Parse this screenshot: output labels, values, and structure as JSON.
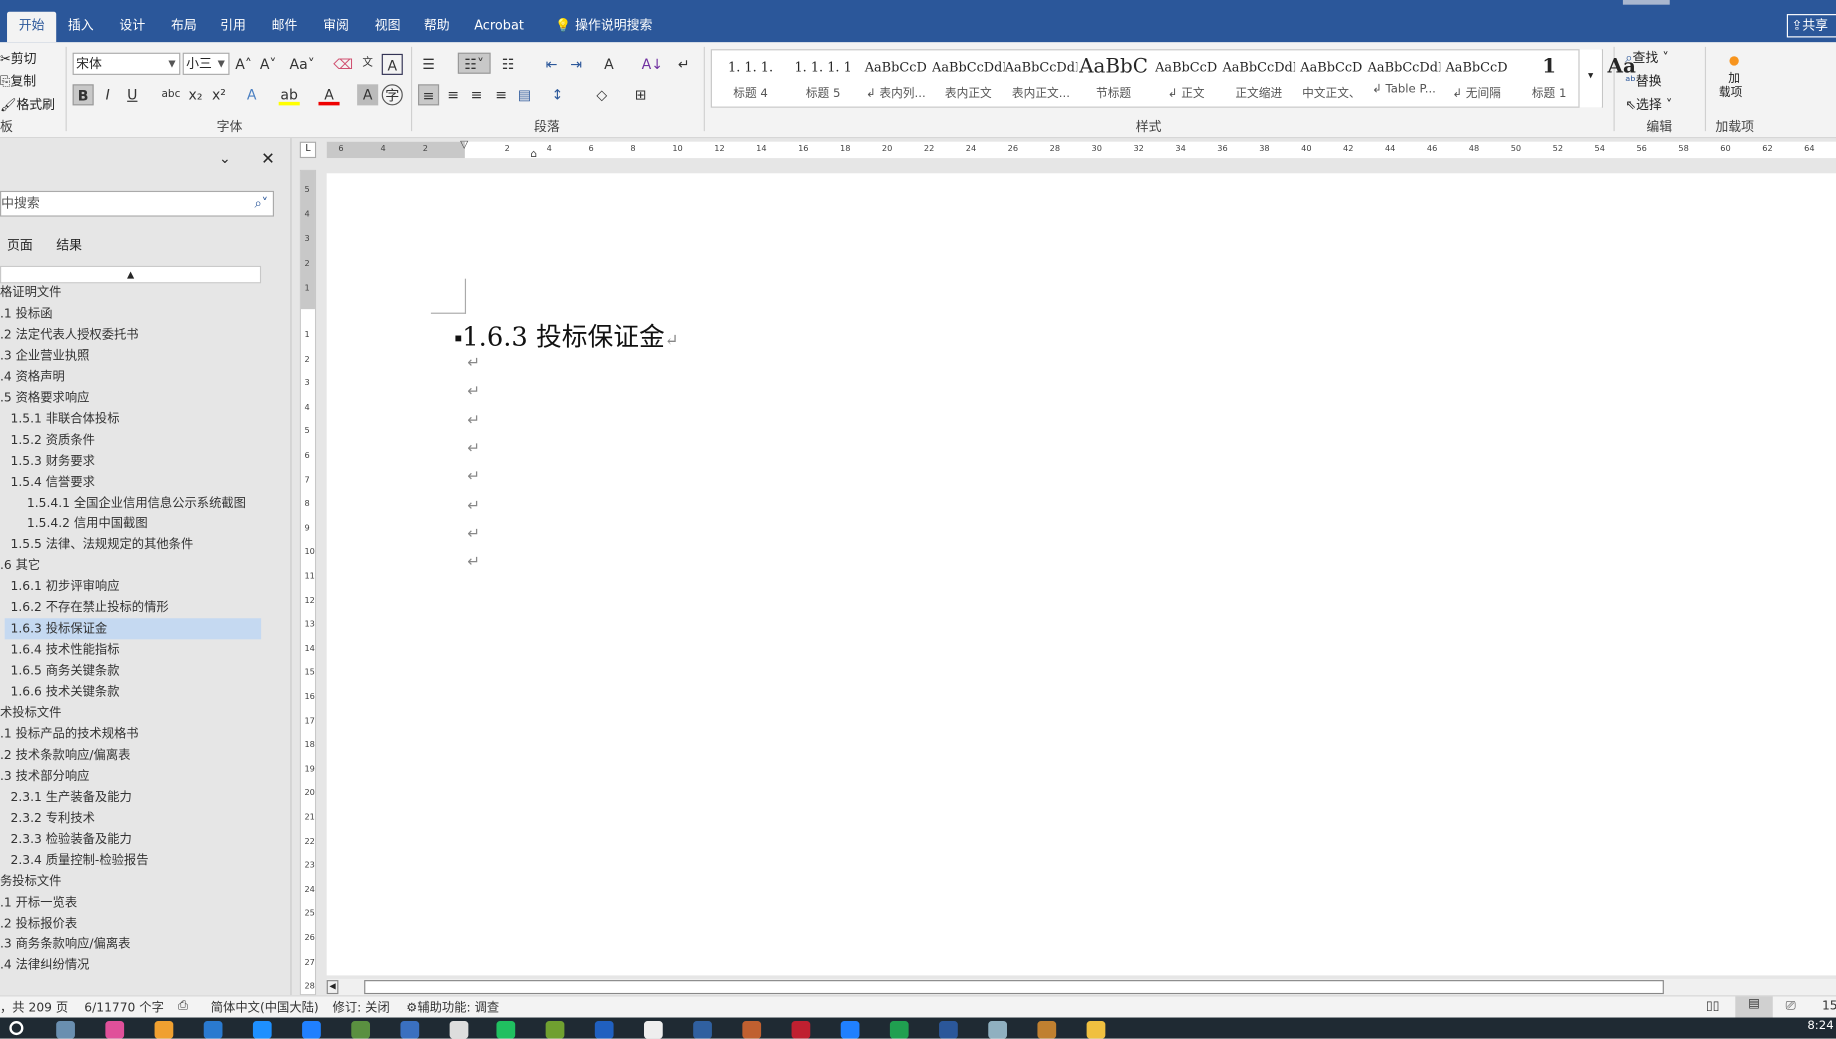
{
  "ribbon_tabs": [
    "开始",
    "插入",
    "设计",
    "布局",
    "引用",
    "邮件",
    "审阅",
    "视图",
    "帮助",
    "Acrobat"
  ],
  "tell_me": "操作说明搜索",
  "share": "共享",
  "clipboard": {
    "cut": "剪切",
    "copy": "复制",
    "format_painter": "格式刷",
    "label": "板"
  },
  "font": {
    "name": "宋体",
    "size": "小三",
    "label": "字体"
  },
  "paragraph": {
    "label": "段落"
  },
  "styles": {
    "label": "样式",
    "items": [
      {
        "preview": "1. 1. 1.",
        "name": "标题 4"
      },
      {
        "preview": "1. 1. 1. 1",
        "name": "标题 5"
      },
      {
        "preview": "AaBbCcD",
        "name": "↲ 表内列..."
      },
      {
        "preview": "AaBbCcDdI",
        "name": "表内正文"
      },
      {
        "preview": "AaBbCcDdI",
        "name": "表内正文..."
      },
      {
        "preview": "AaBbC",
        "name": "节标题"
      },
      {
        "preview": "AaBbCcD",
        "name": "↲ 正文"
      },
      {
        "preview": "AaBbCcDdI",
        "name": "正文缩进"
      },
      {
        "preview": "AaBbCcD",
        "name": "中文正文、"
      },
      {
        "preview": "AaBbCcDdI",
        "name": "↲ Table P..."
      },
      {
        "preview": "AaBbCcD",
        "name": "↲ 无间隔"
      },
      {
        "preview": "1",
        "name": "标题 1"
      },
      {
        "preview": "Aa",
        "name": ""
      }
    ]
  },
  "editing": {
    "find": "查找",
    "replace": "替换",
    "select": "选择",
    "label": "编辑"
  },
  "addins": {
    "button": "加载项",
    "label": "加载项",
    "button_line1": "加",
    "button_line2": "载项"
  },
  "nav": {
    "search_placeholder": "中搜索",
    "tabs": [
      "页面",
      "结果"
    ],
    "items": [
      {
        "text": "格证明文件",
        "level": 0
      },
      {
        "text": ".1 投标函",
        "level": 0
      },
      {
        "text": ".2 法定代表人授权委托书",
        "level": 0
      },
      {
        "text": ".3 企业营业执照",
        "level": 0
      },
      {
        "text": ".4 资格声明",
        "level": 0
      },
      {
        "text": ".5 资格要求响应",
        "level": 0
      },
      {
        "text": "1.5.1 非联合体投标",
        "level": 1
      },
      {
        "text": "1.5.2 资质条件",
        "level": 1
      },
      {
        "text": "1.5.3 财务要求",
        "level": 1
      },
      {
        "text": "1.5.4 信誉要求",
        "level": 1
      },
      {
        "text": "1.5.4.1 全国企业信用信息公示系统截图",
        "level": 2
      },
      {
        "text": "1.5.4.2 信用中国截图",
        "level": 2
      },
      {
        "text": "1.5.5 法律、法规规定的其他条件",
        "level": 1
      },
      {
        "text": ".6 其它",
        "level": 0
      },
      {
        "text": "1.6.1 初步评审响应",
        "level": 1
      },
      {
        "text": "1.6.2 不存在禁止投标的情形",
        "level": 1
      },
      {
        "text": "1.6.3 投标保证金",
        "level": 1,
        "selected": true
      },
      {
        "text": "1.6.4 技术性能指标",
        "level": 1
      },
      {
        "text": "1.6.5 商务关键条款",
        "level": 1
      },
      {
        "text": "1.6.6 技术关键条款",
        "level": 1
      },
      {
        "text": "术投标文件",
        "level": 0
      },
      {
        "text": ".1 投标产品的技术规格书",
        "level": 0
      },
      {
        "text": ".2 技术条款响应/偏离表",
        "level": 0
      },
      {
        "text": ".3 技术部分响应",
        "level": 0
      },
      {
        "text": "2.3.1 生产装备及能力",
        "level": 1
      },
      {
        "text": "2.3.2 专利技术",
        "level": 1
      },
      {
        "text": "2.3.3 检验装备及能力",
        "level": 1
      },
      {
        "text": "2.3.4 质量控制-检验报告",
        "level": 1
      },
      {
        "text": "务投标文件",
        "level": 0
      },
      {
        "text": ".1 开标一览表",
        "level": 0
      },
      {
        "text": ".2 投标报价表",
        "level": 0
      },
      {
        "text": ".3 商务条款响应/偏离表",
        "level": 0
      },
      {
        "text": ".4 法律纠纷情况",
        "level": 0
      }
    ]
  },
  "document": {
    "heading": "1.6.3 投标保证金",
    "paragraph_mark": "↵",
    "empty_paragraphs": 8
  },
  "status": {
    "page": "，共 209 页",
    "words": "6/11770 个字",
    "language": "简体中文(中国大陆)",
    "track": "修订: 关闭",
    "accessibility": "辅助功能: 调查",
    "zoom": "15"
  },
  "clock": "8:24",
  "colors": {
    "title_bar": "#2b579a",
    "selection": "#c5d9f1",
    "taskbar": "#1f2a33"
  }
}
